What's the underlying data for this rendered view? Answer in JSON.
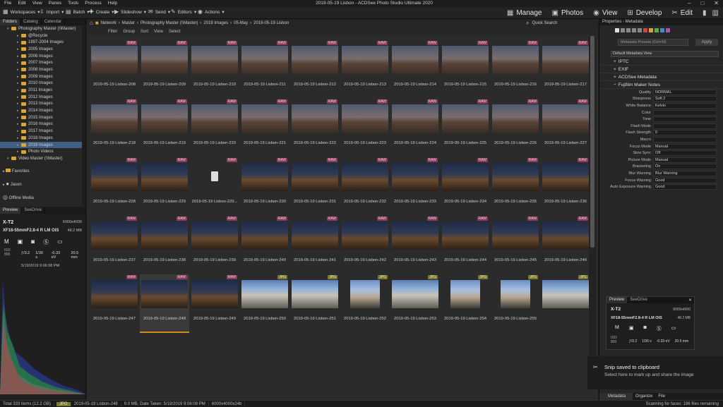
{
  "window": {
    "title": "2019-05-19 Lisbon - ACDSee Photo Studio Ultimate 2020"
  },
  "menu": [
    "File",
    "Edit",
    "View",
    "Panes",
    "Tools",
    "Process",
    "Help"
  ],
  "toolbar": {
    "workspaces": "Workspaces",
    "import": "Import",
    "batch": "Batch",
    "create": "Create",
    "slideshow": "Slideshow",
    "send": "Send",
    "editors": "Editors",
    "actions": "Actions"
  },
  "modes": [
    "Manage",
    "Photos",
    "View",
    "Develop",
    "Edit"
  ],
  "left_tabs": [
    "Folders",
    "Catalog",
    "Calendar"
  ],
  "tree": [
    {
      "label": "Photography Master (\\\\Master)",
      "level": 0
    },
    {
      "label": "@Recycle",
      "level": 1
    },
    {
      "label": "1997-2004 Images",
      "level": 1
    },
    {
      "label": "2005 Images",
      "level": 1
    },
    {
      "label": "2006 Images",
      "level": 1
    },
    {
      "label": "2007 Images",
      "level": 1
    },
    {
      "label": "2008 Images",
      "level": 1
    },
    {
      "label": "2009 Images",
      "level": 1
    },
    {
      "label": "2010 Images",
      "level": 1
    },
    {
      "label": "2011 Images",
      "level": 1
    },
    {
      "label": "2012 Images",
      "level": 1
    },
    {
      "label": "2013 Images",
      "level": 1
    },
    {
      "label": "2014 Images",
      "level": 1
    },
    {
      "label": "2015 Images",
      "level": 1
    },
    {
      "label": "2016 Images",
      "level": 1
    },
    {
      "label": "2017 Images",
      "level": 1
    },
    {
      "label": "2018 Images",
      "level": 1
    },
    {
      "label": "2019 Images",
      "level": 1,
      "selected": true
    },
    {
      "label": "Photo Videos",
      "level": 1
    },
    {
      "label": "Video Master (\\\\Master)",
      "level": 0
    }
  ],
  "tree_bottom": [
    "Favorites",
    "Jason",
    "Offline Media"
  ],
  "preview_tabs": [
    "Preview",
    "SeeDrive"
  ],
  "preview": {
    "camera": "X-T2",
    "resolution": "6000x4000",
    "lens": "XF18-55mmF2.8-4 R LM OIS",
    "size": "48.2 MB",
    "iso_label": "ISO",
    "iso": "800",
    "aperture": "ƒ/3.2",
    "shutter": "1/30 s",
    "ev": "-0.33 eV",
    "focal": "20.5 mm",
    "datetime": "5/19/2019 9:06:08 PM"
  },
  "breadcrumb": [
    "Network",
    "Master",
    "Photography Master (\\\\Master)",
    "2019 Images",
    "05-May",
    "2019-05-19 Lisbon"
  ],
  "quick_search": "Quick Search",
  "filterbar": [
    "Filter",
    "Group",
    "Sort",
    "View",
    "Select"
  ],
  "thumbs": [
    [
      "2019-05-19 Lisbon-208",
      "2019-05-19 Lisbon-209",
      "2019-05-19 Lisbon-210",
      "2019-05-19 Lisbon-211",
      "2019-05-19 Lisbon-212",
      "2019-05-19 Lisbon-213",
      "2019-05-19 Lisbon-214",
      "2019-05-19 Lisbon-215",
      "2019-05-19 Lisbon-216",
      "2019-05-19 Lisbon-217"
    ],
    [
      "2019-05-19 Lisbon-218",
      "2019-05-19 Lisbon-219",
      "2019-05-19 Lisbon-220",
      "2019-05-19 Lisbon-221",
      "2019-05-19 Lisbon-222",
      "2019-05-19 Lisbon-223",
      "2019-05-19 Lisbon-224",
      "2019-05-19 Lisbon-225",
      "2019-05-19 Lisbon-226",
      "2019-05-19 Lisbon-227"
    ],
    [
      "2019-05-19 Lisbon-228",
      "2019-05-19 Lisbon-229",
      "2019-05-19 Lisbon-229...",
      "2019-05-19 Lisbon-230",
      "2019-05-19 Lisbon-231",
      "2019-05-19 Lisbon-232",
      "2019-05-19 Lisbon-233",
      "2019-05-19 Lisbon-234",
      "2019-05-19 Lisbon-235",
      "2019-05-19 Lisbon-236"
    ],
    [
      "2019-05-19 Lisbon-237",
      "2019-05-19 Lisbon-238",
      "2019-05-19 Lisbon-239",
      "2019-05-19 Lisbon-240",
      "2019-05-19 Lisbon-241",
      "2019-05-19 Lisbon-242",
      "2019-05-19 Lisbon-243",
      "2019-05-19 Lisbon-244",
      "2019-05-19 Lisbon-245",
      "2019-05-19 Lisbon-246"
    ],
    [
      "2019-05-19 Lisbon-247",
      "2019-05-19 Lisbon-248",
      "2019-05-19 Lisbon-249",
      "2019-05-19 Lisbon-250",
      "2019-05-19 Lisbon-251",
      "2019-05-19 Lisbon-252",
      "2019-05-19 Lisbon-253",
      "2019-05-19 Lisbon-254",
      "2019-05-19 Lisbon-255",
      ""
    ]
  ],
  "badge_raw": "RAW",
  "badge_jpg": "JPG",
  "properties": {
    "title": "Properties - Metadata",
    "presets": "Metadata Presets (Ctrl+M)",
    "apply": "Apply",
    "view": "Default Metadata View",
    "sections": [
      "IPTC",
      "EXIF",
      "ACDSee Metadata",
      "Fujifilm Maker Notes"
    ]
  },
  "maker_notes": [
    {
      "k": "Quality",
      "v": "NORMAL"
    },
    {
      "k": "Sharpness",
      "v": "Soft 2"
    },
    {
      "k": "White Balance",
      "v": "Kelvin"
    },
    {
      "k": "Color",
      "v": ""
    },
    {
      "k": "Tone",
      "v": ""
    },
    {
      "k": "Flash Mode",
      "v": ""
    },
    {
      "k": "Flash Strength",
      "v": "0"
    },
    {
      "k": "Macro",
      "v": ""
    },
    {
      "k": "Focus Mode",
      "v": "Manual"
    },
    {
      "k": "Slow Sync",
      "v": "Off"
    },
    {
      "k": "Picture Mode",
      "v": "Manual"
    },
    {
      "k": "Bracketing",
      "v": "On"
    },
    {
      "k": "Blur Warning",
      "v": "Blur Warning"
    },
    {
      "k": "Focus Warning",
      "v": "Good"
    },
    {
      "k": "Auto Exposure Warning",
      "v": "Good"
    }
  ],
  "right_bottom_tabs": [
    "Metadata",
    "Organize",
    "File"
  ],
  "toast": {
    "title": "Snip saved to clipboard",
    "body": "Select here to mark up and share the image"
  },
  "status": {
    "total": "Total 333 items (12.2 GB)",
    "jpg": "JPG",
    "file": "2019-05-19 Lisbon-248",
    "info": "9.0 MB, Date Taken: 5/19/2019 9:06:08 PM",
    "dims": "6000x4000x24b",
    "scan": "Scanning for faces: 186 files remaining"
  }
}
